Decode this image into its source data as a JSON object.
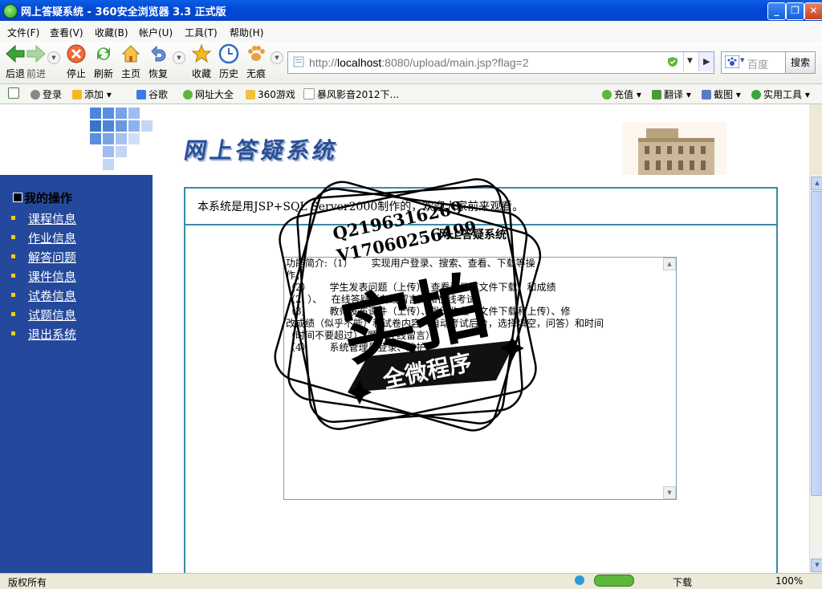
{
  "window": {
    "title": "网上答疑系统 - 360安全浏览器 3.3 正式版"
  },
  "menu": [
    "文件(F)",
    "查看(V)",
    "收藏(B)",
    "帐户(U)",
    "工具(T)",
    "帮助(H)"
  ],
  "toolbar": {
    "back": "后退",
    "forward": "前进",
    "stop": "停止",
    "refresh": "刷新",
    "home": "主页",
    "restore": "恢复",
    "favorites": "收藏",
    "history": "历史",
    "incognito": "无痕"
  },
  "address": {
    "prefix": "http://",
    "host": "localhost",
    "rest": ":8080/upload/main.jsp?flag=2"
  },
  "search": {
    "placeholder": "百度",
    "button": "搜索"
  },
  "favbar": {
    "login": "登录",
    "add": "添加",
    "google": "谷歌",
    "sites": "网址大全",
    "games": "360游戏",
    "storm": "暴风影音2012下...",
    "recharge": "充值",
    "translate": "翻译",
    "screenshot": "截图",
    "tools": "实用工具"
  },
  "site": {
    "logo_text": "网上答疑系统"
  },
  "sidebar": {
    "title": "我的操作",
    "items": [
      {
        "label": "课程信息"
      },
      {
        "label": "作业信息"
      },
      {
        "label": "解答问题"
      },
      {
        "label": "课件信息"
      },
      {
        "label": "试卷信息"
      },
      {
        "label": "试题信息"
      },
      {
        "label": "退出系统"
      }
    ]
  },
  "main": {
    "intro": "本系统是用JSP+SQL Server2000制作的，欢迎大家前来观看。",
    "box_title": "网上答疑系统",
    "description": "功能简介:（1）      实现用户登录、搜索、查看、下载等操\n作；\n（2）      学生发表问题（上传）、查看课件（文件下载）和成绩\n（2  ）、   在线答疑（在线留言）和在线考试\n（3）      教师发布课件（上传）、批改作业（文件下载和上传）、修\n改成绩（似乎不能）和试卷内容（自动考试后台，选择填空，问答）和时间\n（时间不要超过），题（在线留言）\n（4）      系统管理员登录、维护"
  },
  "watermark": {
    "line1": "Q2196316269",
    "line2": "V17060256499",
    "big": "实拍",
    "banner": "全微程序"
  },
  "statusbar": {
    "text": "版权所有",
    "download": "下载",
    "zoom": "100%"
  }
}
